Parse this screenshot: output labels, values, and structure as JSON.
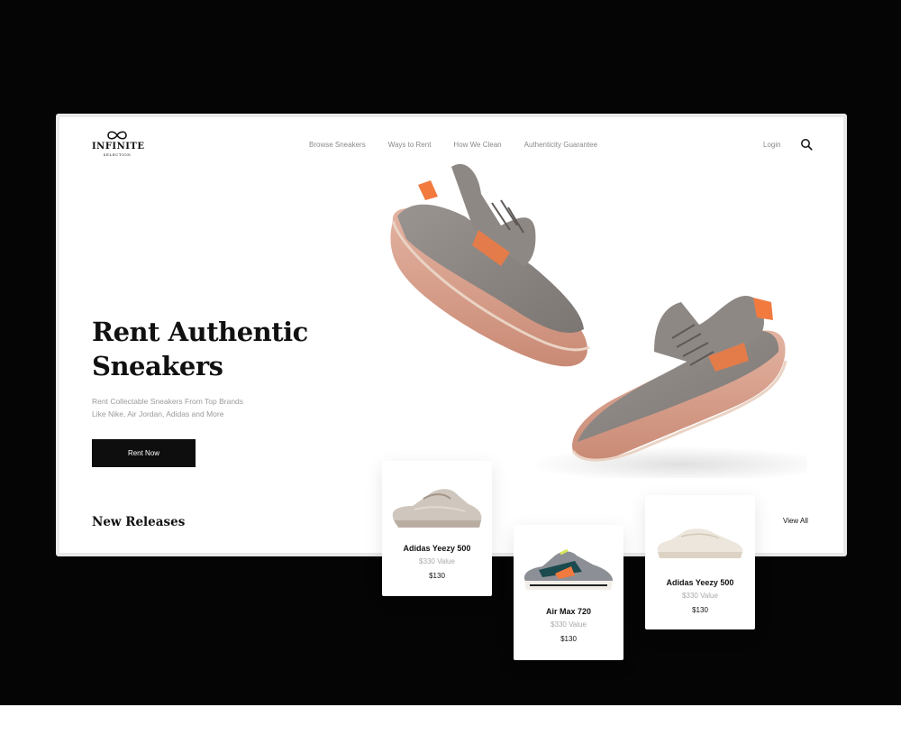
{
  "brand": {
    "name": "INFINITE",
    "tagline": "SELECTION"
  },
  "nav": {
    "items": [
      "Browse Sneakers",
      "Ways to Rent",
      "How We Clean",
      "Authenticity Guarantee"
    ],
    "login": "Login",
    "search_icon": "search-icon"
  },
  "hero": {
    "title_line1": "Rent Authentic",
    "title_line2": "Sneakers",
    "subtitle_line1": "Rent Collectable Sneakers From Top Brands",
    "subtitle_line2": "Like Nike, Air Jordan, Adidas and More",
    "cta": "Rent Now"
  },
  "releases": {
    "heading": "New Releases",
    "view_all": "View All",
    "products": [
      {
        "name": "Adidas Yeezy 500",
        "value": "$330 Value",
        "price": "$130"
      },
      {
        "name": "Air Max 720",
        "value": "$330 Value",
        "price": "$130"
      },
      {
        "name": "Adidas Yeezy 500",
        "value": "$330 Value",
        "price": "$130"
      }
    ]
  },
  "colors": {
    "background": "#050505",
    "accent_orange": "#f27a3f",
    "shoe_grey": "#8b8582",
    "sole_pink": "#d9a28d",
    "text_dark": "#111111",
    "text_muted": "#9a9a9a"
  }
}
